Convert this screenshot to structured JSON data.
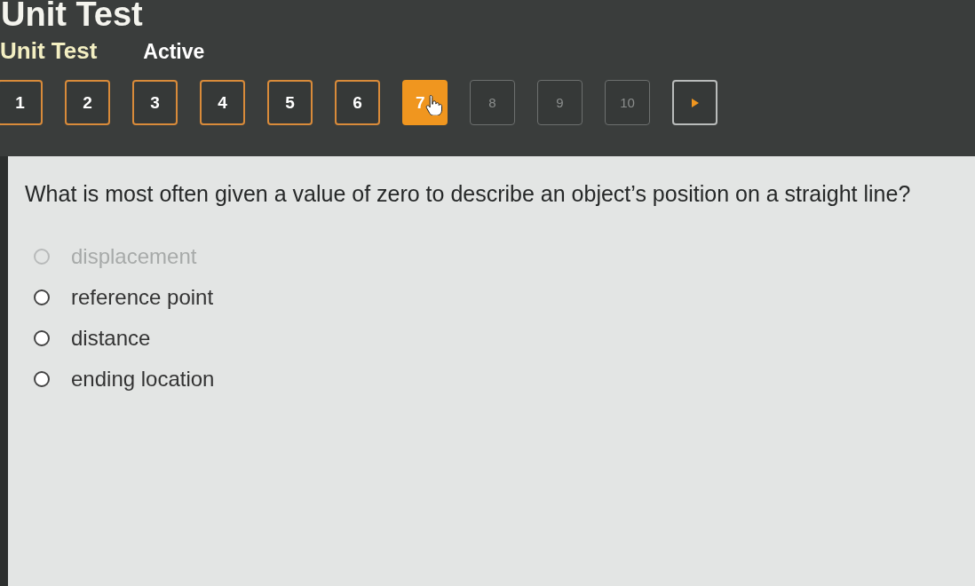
{
  "window": {
    "title": "Unit Test"
  },
  "test": {
    "name": "Unit Test",
    "status": "Active"
  },
  "questions": [
    {
      "label": "1",
      "answered": true,
      "selected": false
    },
    {
      "label": "2",
      "answered": true,
      "selected": false
    },
    {
      "label": "3",
      "answered": true,
      "selected": false
    },
    {
      "label": "4",
      "answered": true,
      "selected": false
    },
    {
      "label": "5",
      "answered": true,
      "selected": false
    },
    {
      "label": "6",
      "answered": true,
      "selected": false
    },
    {
      "label": "7",
      "answered": false,
      "selected": true
    },
    {
      "label": "8",
      "answered": false,
      "selected": false
    },
    {
      "label": "9",
      "answered": false,
      "selected": false
    },
    {
      "label": "10",
      "answered": false,
      "selected": false
    }
  ],
  "question": {
    "text": "What is most often given a value of zero to describe an object’s position on a straight line?"
  },
  "options": [
    {
      "label": "displacement",
      "disabled": true,
      "selected": false
    },
    {
      "label": "reference point",
      "disabled": false,
      "selected": false
    },
    {
      "label": "distance",
      "disabled": false,
      "selected": false
    },
    {
      "label": "ending location",
      "disabled": false,
      "selected": false
    }
  ]
}
